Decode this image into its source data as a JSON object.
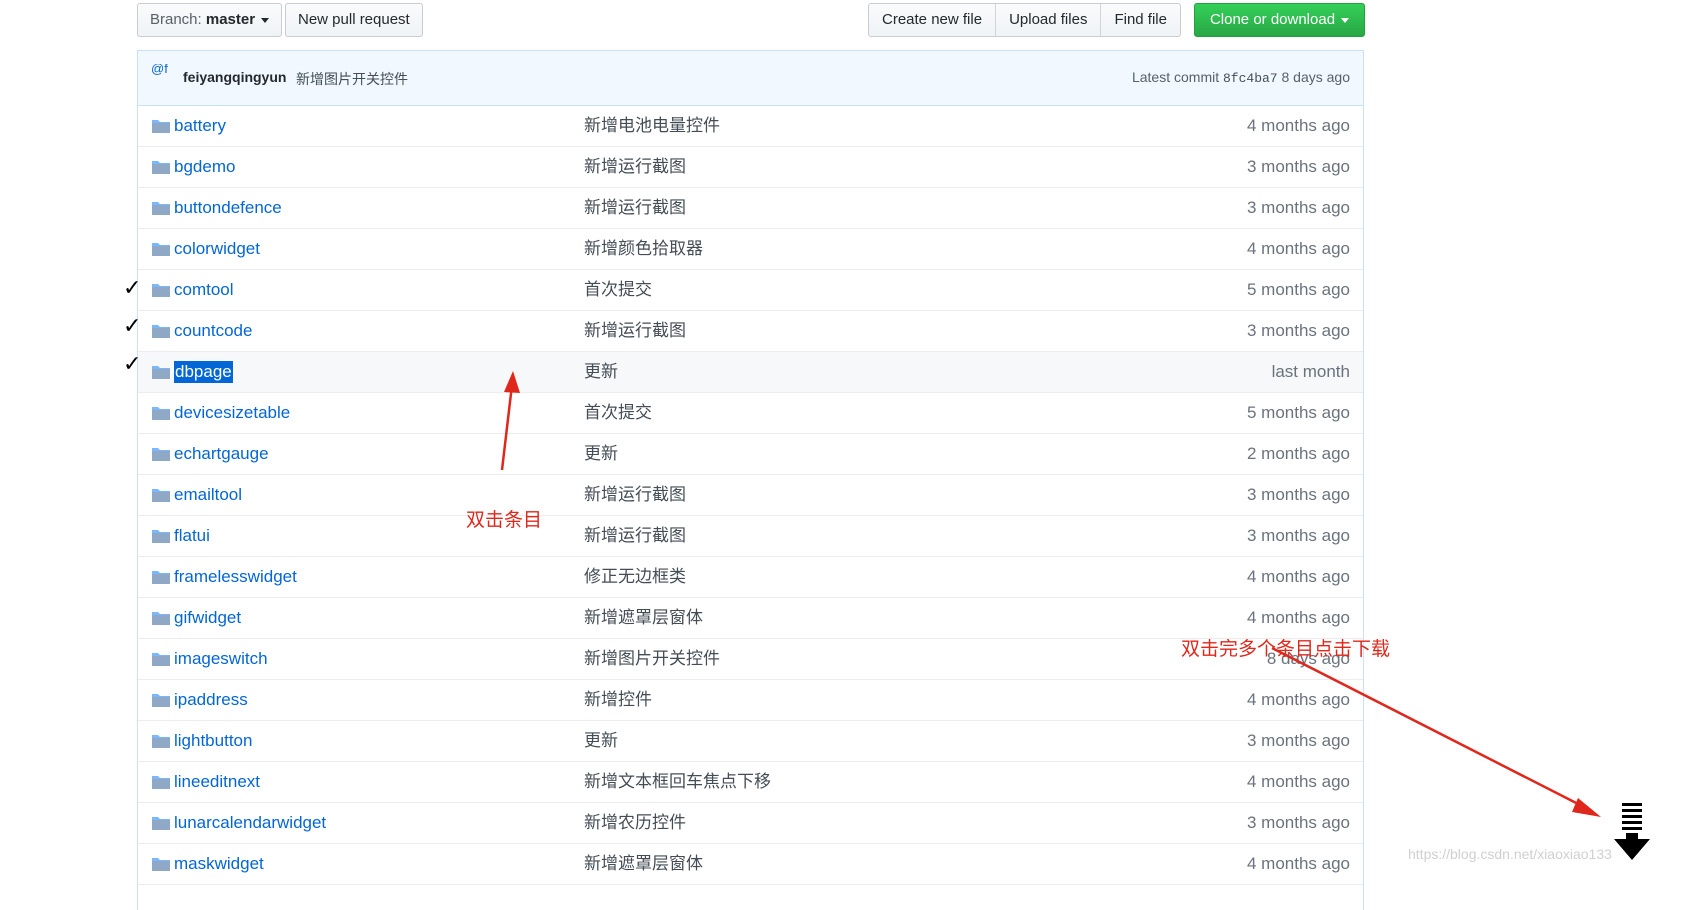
{
  "toolbar": {
    "branch_prefix": "Branch:",
    "branch_name": "master",
    "new_pull_request": "New pull request",
    "create_new_file": "Create new file",
    "upload_files": "Upload files",
    "find_file": "Find file",
    "clone_or_download": "Clone or download"
  },
  "commit": {
    "avatar_text": "@f",
    "author": "feiyangqingyun",
    "message": "新增图片开关控件",
    "latest_prefix": "Latest commit",
    "sha": "8fc4ba7",
    "age": "8 days ago"
  },
  "files": [
    {
      "name": "battery",
      "message": "新增电池电量控件",
      "age": "4 months ago"
    },
    {
      "name": "bgdemo",
      "message": "新增运行截图",
      "age": "3 months ago"
    },
    {
      "name": "buttondefence",
      "message": "新增运行截图",
      "age": "3 months ago"
    },
    {
      "name": "colorwidget",
      "message": "新增颜色拾取器",
      "age": "4 months ago"
    },
    {
      "name": "comtool",
      "message": "首次提交",
      "age": "5 months ago"
    },
    {
      "name": "countcode",
      "message": "新增运行截图",
      "age": "3 months ago"
    },
    {
      "name": "dbpage",
      "message": "更新",
      "age": "last month"
    },
    {
      "name": "devicesizetable",
      "message": "首次提交",
      "age": "5 months ago"
    },
    {
      "name": "echartgauge",
      "message": "更新",
      "age": "2 months ago"
    },
    {
      "name": "emailtool",
      "message": "新增运行截图",
      "age": "3 months ago"
    },
    {
      "name": "flatui",
      "message": "新增运行截图",
      "age": "3 months ago"
    },
    {
      "name": "framelesswidget",
      "message": "修正无边框类",
      "age": "4 months ago"
    },
    {
      "name": "gifwidget",
      "message": "新增遮罩层窗体",
      "age": "4 months ago"
    },
    {
      "name": "imageswitch",
      "message": "新增图片开关控件",
      "age": "8 days ago"
    },
    {
      "name": "ipaddress",
      "message": "新增控件",
      "age": "4 months ago"
    },
    {
      "name": "lightbutton",
      "message": "更新",
      "age": "3 months ago"
    },
    {
      "name": "lineeditnext",
      "message": "新增文本框回车焦点下移",
      "age": "4 months ago"
    },
    {
      "name": "lunarcalendarwidget",
      "message": "新增农历控件",
      "age": "3 months ago"
    },
    {
      "name": "maskwidget",
      "message": "新增遮罩层窗体",
      "age": "4 months ago"
    }
  ],
  "checkmarks": [
    "✓",
    "✓",
    "✓"
  ],
  "annotations": {
    "double_click_item": "双击条目",
    "double_click_then_download": "双击完多个条目点击下载"
  },
  "watermark": "https://blog.csdn.net/xiaoxiao133",
  "colors": {
    "link": "#0366d6",
    "annotation_red": "#e0271b",
    "green_button": "#28a745"
  }
}
